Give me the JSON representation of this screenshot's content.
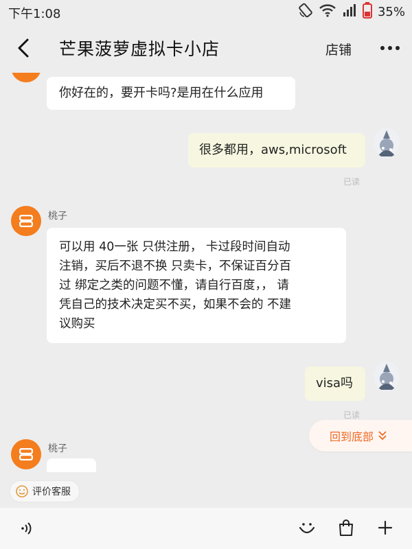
{
  "status": {
    "time": "下午1:08",
    "battery": "35%"
  },
  "header": {
    "title": "芒果菠萝虚拟卡小店",
    "shop_link": "店铺"
  },
  "messages": [
    {
      "side": "left",
      "text": "你好在的，要开卡吗?是用在什么应用"
    },
    {
      "side": "right",
      "text": "很多都用，aws,microsoft",
      "status": "已读"
    },
    {
      "side": "left",
      "sender": "桃子",
      "lines": [
        "可以用  40一张  只供注册，  卡过段时间自动",
        "注销，买后不退不换 只卖卡，不保证百分百",
        "过  绑定之类的问题不懂，请自行百度，，  请",
        "凭自己的技术决定买不买，如果不会的 不建",
        "议购买"
      ]
    },
    {
      "side": "right",
      "text": "visa吗",
      "status": "已读"
    },
    {
      "side": "left",
      "sender": "桃子"
    }
  ],
  "back_to_bottom": "回到底部",
  "service": {
    "rate_label": "评价客服"
  },
  "input": {
    "placeholder": ""
  },
  "colors": {
    "accent": "#f47d1e",
    "bubble_right": "#f7f7e1",
    "link": "#ee6a24"
  }
}
